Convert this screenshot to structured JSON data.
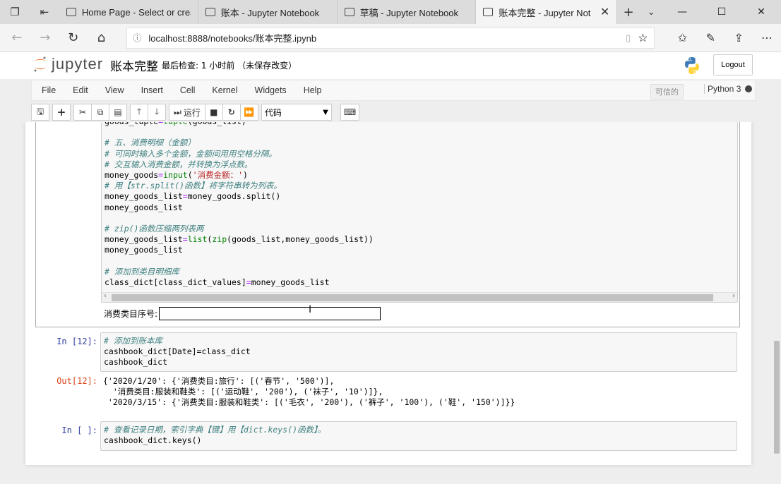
{
  "browser": {
    "tabs": [
      {
        "title": "Home Page - Select or crea",
        "active": false
      },
      {
        "title": "账本 - Jupyter Notebook",
        "active": false
      },
      {
        "title": "草稿 - Jupyter Notebook",
        "active": false
      },
      {
        "title": "账本完整 - Jupyter Not",
        "active": true
      }
    ],
    "url": "localhost:8888/notebooks/账本完整.ipynb"
  },
  "jupyter": {
    "logo_text": "jupyter",
    "notebook_name": "账本完整",
    "checkpoint": "最后检查: 1 小时前 （未保存改变）",
    "logout_label": "Logout",
    "menu": [
      "File",
      "Edit",
      "View",
      "Insert",
      "Cell",
      "Kernel",
      "Widgets",
      "Help"
    ],
    "trusted_label": "可信的",
    "kernel_name": "Python 3",
    "toolbar": {
      "run_label": "运行",
      "cell_type": "代码"
    }
  },
  "cells": {
    "selected": {
      "stdin_prompt": "消费类目序号:"
    },
    "cell12": {
      "in_prompt": "In  [12]:",
      "out_prompt": "Out[12]:",
      "code": [
        "# 添加到账本库",
        "cashbook_dict[Date]=class_dict",
        "cashbook_dict"
      ],
      "output": [
        "{'2020/1/20': {'消费类目:旅行': [('春节', '500')],",
        "  '消费类目:服装和鞋类': [('运动鞋', '200'), ('袜子', '10')]},",
        " '2020/3/15': {'消费类目:服装和鞋类': [('毛衣', '200'), ('裤子', '100'), ('鞋', '150')]}}"
      ]
    },
    "last": {
      "in_prompt": "In  [ ]:",
      "comment": "# 查看记录日期，索引字典【键】用【dict.keys()函数】。",
      "code": "cashbook_dict.keys()"
    }
  }
}
